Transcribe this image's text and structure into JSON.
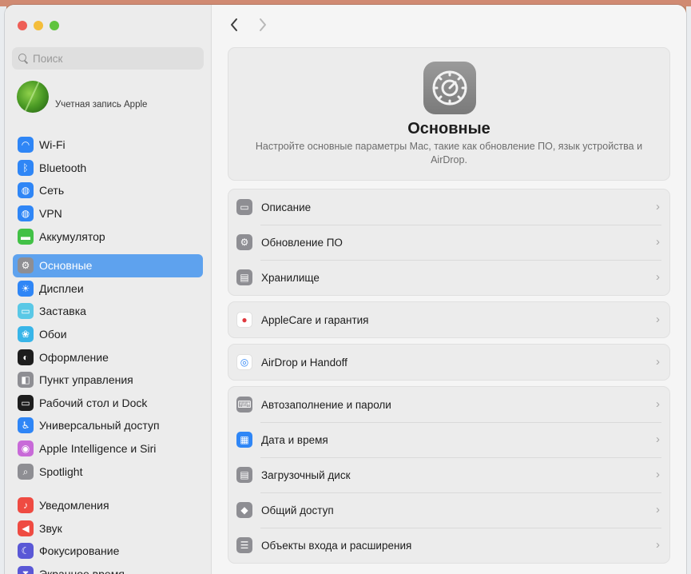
{
  "window": {
    "title": "Основные"
  },
  "search": {
    "placeholder": "Поиск"
  },
  "account": {
    "label": "Учетная запись Apple"
  },
  "sidebar": {
    "groups": [
      [
        {
          "label": "Wi-Fi",
          "icon": "wifi-icon",
          "color": "#2f86f6"
        },
        {
          "label": "Bluetooth",
          "icon": "bluetooth-icon",
          "color": "#2f86f6"
        },
        {
          "label": "Сеть",
          "icon": "globe-icon",
          "color": "#2f86f6"
        },
        {
          "label": "VPN",
          "icon": "vpn-globe-icon",
          "color": "#2f86f6"
        },
        {
          "label": "Аккумулятор",
          "icon": "battery-icon",
          "color": "#42c146"
        }
      ],
      [
        {
          "label": "Основные",
          "icon": "gear-icon",
          "color": "#8e8e93",
          "active": true
        },
        {
          "label": "Дисплеи",
          "icon": "sun-icon",
          "color": "#2f86f6"
        },
        {
          "label": "Заставка",
          "icon": "screensaver-icon",
          "color": "#5ac8e6"
        },
        {
          "label": "Обои",
          "icon": "flower-icon",
          "color": "#38b5e8"
        },
        {
          "label": "Оформление",
          "icon": "appearance-icon",
          "color": "#1d1d1d"
        },
        {
          "label": "Пункт управления",
          "icon": "control-center-icon",
          "color": "#8e8e93"
        },
        {
          "label": "Рабочий стол и Dock",
          "icon": "dock-icon",
          "color": "#1d1d1d"
        },
        {
          "label": "Универсальный доступ",
          "icon": "accessibility-icon",
          "color": "#2f86f6"
        },
        {
          "label": "Apple Intelligence и Siri",
          "icon": "siri-icon",
          "color": "#c86ad8"
        },
        {
          "label": "Spotlight",
          "icon": "spotlight-icon",
          "color": "#8e8e93"
        }
      ],
      [
        {
          "label": "Уведомления",
          "icon": "bell-icon",
          "color": "#ef4b42"
        },
        {
          "label": "Звук",
          "icon": "speaker-icon",
          "color": "#ef4b42"
        },
        {
          "label": "Фокусирование",
          "icon": "moon-icon",
          "color": "#5a58d6"
        },
        {
          "label": "Экранное время",
          "icon": "hourglass-icon",
          "color": "#5a58d6"
        }
      ]
    ]
  },
  "main": {
    "hero": {
      "title": "Основные",
      "description": "Настройте основные параметры Mac, такие как обновление ПО, язык устройства и AirDrop."
    },
    "groups": [
      [
        {
          "label": "Описание",
          "icon": "laptop-icon",
          "color": "#8e8e93"
        },
        {
          "label": "Обновление ПО",
          "icon": "gear-badge-icon",
          "color": "#8e8e93"
        },
        {
          "label": "Хранилище",
          "icon": "drive-icon",
          "color": "#8e8e93"
        }
      ],
      [
        {
          "label": "AppleCare и гарантия",
          "icon": "apple-icon",
          "color": "#ffffff"
        }
      ],
      [
        {
          "label": "AirDrop и Handoff",
          "icon": "airdrop-icon",
          "color": "#ffffff"
        }
      ],
      [
        {
          "label": "Автозаполнение и пароли",
          "icon": "keyboard-icon",
          "color": "#8e8e93"
        },
        {
          "label": "Дата и время",
          "icon": "calendar-icon",
          "color": "#2f86f6"
        },
        {
          "label": "Загрузочный диск",
          "icon": "drive-icon",
          "color": "#8e8e93"
        },
        {
          "label": "Общий доступ",
          "icon": "sharing-icon",
          "color": "#8e8e93"
        },
        {
          "label": "Объекты входа и расширения",
          "icon": "list-icon",
          "color": "#8e8e93"
        }
      ]
    ]
  }
}
